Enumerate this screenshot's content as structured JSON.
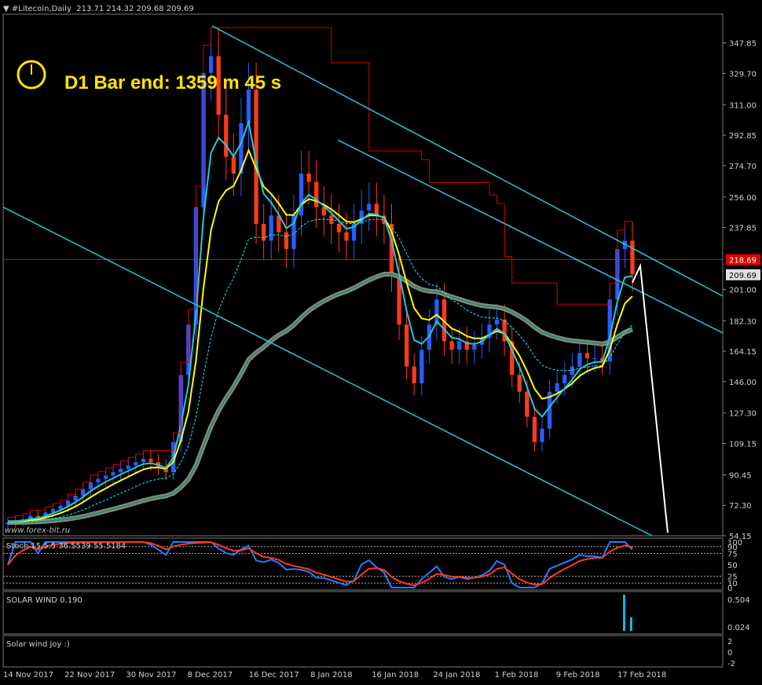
{
  "header": {
    "symbol": "#Litecoin,Daily",
    "ohlc": "213.71 214.32 209.68 209.69"
  },
  "overlay": {
    "timer": "D1 Bar end: 1359 m 45 s",
    "watermark": "www.forex-bit.ru"
  },
  "price_tags": {
    "last": "209.69",
    "line": "218.69"
  },
  "colors": {
    "bull": "#2a5cff",
    "bear": "#ff3a1a",
    "channel": "#27c6d6",
    "donchian": "#d40000",
    "timer": "#ffe300",
    "tag_red": "#e00000"
  },
  "icons": {
    "clock": "clock-icon"
  },
  "chart_data": [
    {
      "type": "candlestick",
      "title": "#Litecoin,Daily",
      "y_ticks": [
        "347.85",
        "329.70",
        "311.00",
        "292.85",
        "274.70",
        "256.00",
        "237.85",
        "218.69",
        "209.69",
        "201.00",
        "182.30",
        "164.15",
        "146.00",
        "127.30",
        "109.15",
        "90.45",
        "72.30",
        "54.15"
      ],
      "ylim": [
        54.15,
        365.0
      ],
      "x_ticks": [
        "14 Nov 2017",
        "22 Nov 2017",
        "30 Nov 2017",
        "8 Dec 2017",
        "16 Dec 2017",
        "8 Jan 2018",
        "16 Jan 2018",
        "24 Jan 2018",
        "1 Feb 2018",
        "9 Feb 2018",
        "17 Feb 2018"
      ],
      "series": [
        {
          "name": "close",
          "values": [
            62,
            63,
            64,
            66,
            65,
            68,
            70,
            72,
            75,
            78,
            82,
            86,
            88,
            90,
            92,
            94,
            96,
            98,
            100,
            98,
            95,
            92,
            110,
            150,
            180,
            250,
            330,
            340,
            305,
            280,
            270,
            300,
            320,
            240,
            230,
            245,
            235,
            225,
            245,
            270,
            265,
            250,
            245,
            240,
            235,
            230,
            240,
            248,
            252,
            245,
            240,
            210,
            180,
            155,
            145,
            165,
            180,
            195,
            170,
            165,
            170,
            165,
            168,
            172,
            180,
            183,
            170,
            150,
            140,
            125,
            110,
            118,
            140,
            145,
            150,
            155,
            163,
            160,
            160,
            158,
            195,
            225,
            230,
            210
          ]
        }
      ]
    },
    {
      "type": "line",
      "title": "Stoch 15,5,5 36.5539 55.5184",
      "y_ticks": [
        "100",
        "90",
        "75",
        "50",
        "25",
        "10",
        "0"
      ],
      "ylim": [
        0,
        100
      ]
    },
    {
      "type": "bar",
      "title": "SOLAR WIND 0.190",
      "y_ticks": [
        "0.504",
        "0.024"
      ],
      "values": [
        0.504,
        0.19
      ]
    },
    {
      "type": "line",
      "title": "Solar wind joy :)",
      "y_ticks": [
        "2",
        "0",
        "-2"
      ]
    }
  ]
}
